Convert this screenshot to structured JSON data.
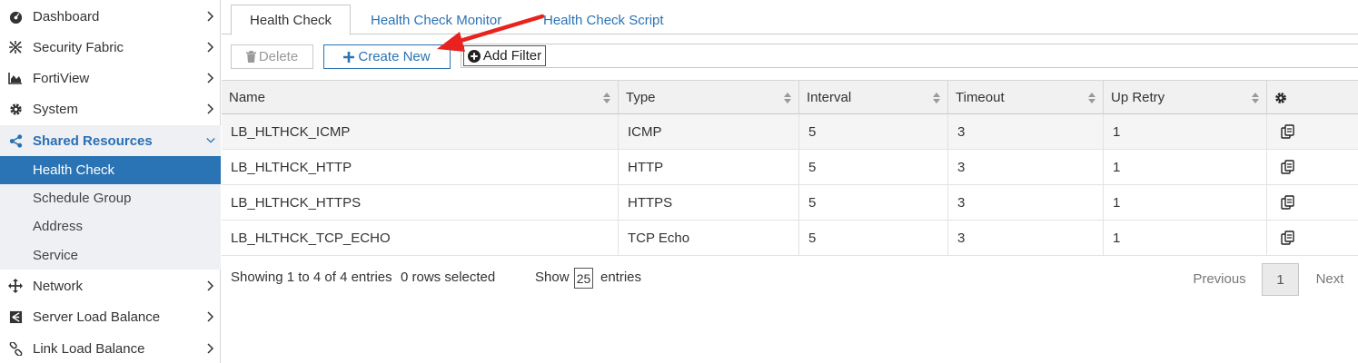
{
  "sidebar": {
    "items": [
      {
        "label": "Dashboard",
        "icon": "dashboard-icon"
      },
      {
        "label": "Security Fabric",
        "icon": "security-fabric-icon"
      },
      {
        "label": "FortiView",
        "icon": "fortiview-icon"
      },
      {
        "label": "System",
        "icon": "gear-icon"
      },
      {
        "label": "Shared Resources",
        "icon": "share-icon"
      },
      {
        "label": "Health Check"
      },
      {
        "label": "Schedule Group"
      },
      {
        "label": "Address"
      },
      {
        "label": "Service"
      },
      {
        "label": "Network",
        "icon": "network-icon"
      },
      {
        "label": "Server Load Balance",
        "icon": "server-load-balance-icon"
      },
      {
        "label": "Link Load Balance",
        "icon": "link-icon"
      }
    ]
  },
  "tabs": [
    {
      "label": "Health Check"
    },
    {
      "label": "Health Check Monitor"
    },
    {
      "label": "Health Check Script"
    }
  ],
  "toolbar": {
    "delete_label": "Delete",
    "create_label": "Create New",
    "filter_label": "Add Filter"
  },
  "table": {
    "columns": [
      "Name",
      "Type",
      "Interval",
      "Timeout",
      "Up Retry"
    ],
    "rows": [
      {
        "name": "LB_HLTHCK_ICMP",
        "type": "ICMP",
        "interval": "5",
        "timeout": "3",
        "up_retry": "1"
      },
      {
        "name": "LB_HLTHCK_HTTP",
        "type": "HTTP",
        "interval": "5",
        "timeout": "3",
        "up_retry": "1"
      },
      {
        "name": "LB_HLTHCK_HTTPS",
        "type": "HTTPS",
        "interval": "5",
        "timeout": "3",
        "up_retry": "1"
      },
      {
        "name": "LB_HLTHCK_TCP_ECHO",
        "type": "TCP Echo",
        "interval": "5",
        "timeout": "3",
        "up_retry": "1"
      }
    ]
  },
  "footer": {
    "showing": "Showing 1 to 4 of 4 entries",
    "selected": "0 rows selected",
    "show_label": "Show",
    "page_size": "25",
    "entries_label": "entries",
    "previous": "Previous",
    "page": "1",
    "next": "Next"
  },
  "colors": {
    "accent": "#2a73b5",
    "annotation": "#e8231f"
  }
}
